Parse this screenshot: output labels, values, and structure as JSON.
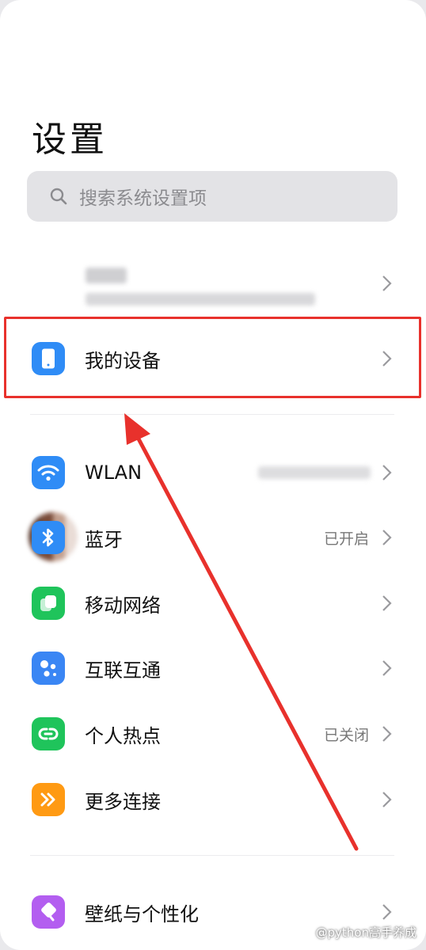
{
  "header": {
    "title": "设置"
  },
  "search": {
    "placeholder": "搜索系统设置项"
  },
  "profile": {
    "name": ""
  },
  "my_device": {
    "label": "我的设备"
  },
  "connectivity": [
    {
      "key": "wlan",
      "label": "WLAN",
      "status": "",
      "icon": "wifi-icon",
      "color": "#2f8cf6"
    },
    {
      "key": "bluetooth",
      "label": "蓝牙",
      "status": "已开启",
      "icon": "bluetooth-icon",
      "color": "#2f8cf6"
    },
    {
      "key": "mobile",
      "label": "移动网络",
      "status": "",
      "icon": "mobile-network-icon",
      "color": "#1fc45b"
    },
    {
      "key": "interconnect",
      "label": "互联互通",
      "status": "",
      "icon": "interconnect-icon",
      "color": "#3a86f4"
    },
    {
      "key": "hotspot",
      "label": "个人热点",
      "status": "已关闭",
      "icon": "hotspot-icon",
      "color": "#1fc45b"
    },
    {
      "key": "more",
      "label": "更多连接",
      "status": "",
      "icon": "more-connections-icon",
      "color": "#ff9a13"
    }
  ],
  "personalization": {
    "label": "壁纸与个性化",
    "icon": "wallpaper-icon",
    "color": "#b35ef0"
  },
  "annotation": {
    "color": "#e8312c"
  },
  "watermark": "@python高手养成"
}
